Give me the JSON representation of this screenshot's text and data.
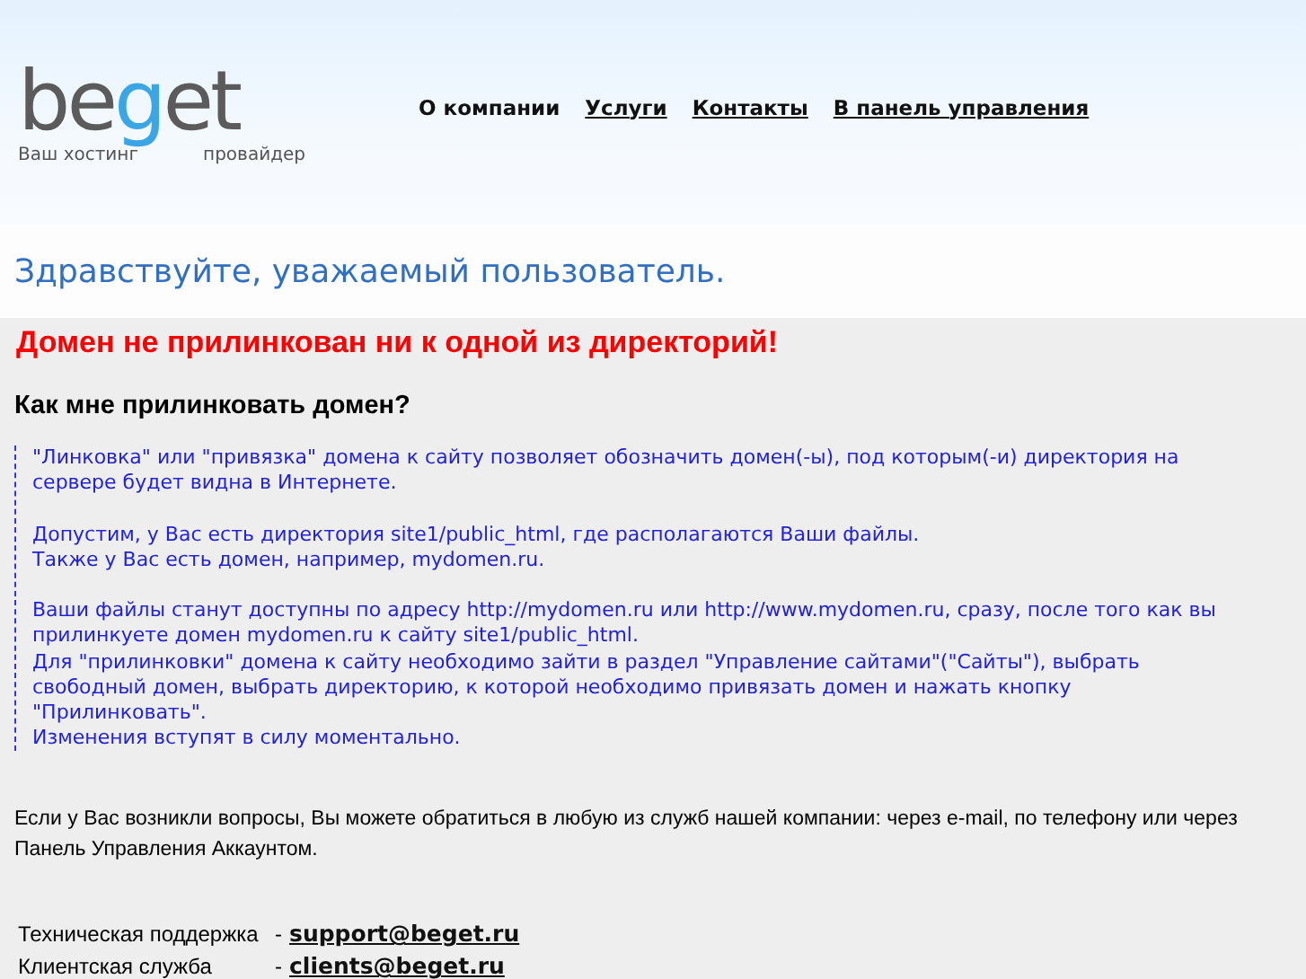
{
  "logo": {
    "name": "beget",
    "tagline_left": "Ваш  хостинг",
    "tagline_right": "провайдер"
  },
  "nav": [
    {
      "label": "О компании",
      "link": false
    },
    {
      "label": "Услуги",
      "link": true
    },
    {
      "label": "Контакты",
      "link": true
    },
    {
      "label": "В панель управления",
      "link": true
    }
  ],
  "greeting": "Здравствуйте, уважаемый пользователь.",
  "error": "Домен не прилинкован ни к одной из директорий!",
  "question": "Как мне прилинковать домен?",
  "instructions": [
    [
      "\"Линковка\" или \"привязка\" домена к сайту позволяет обозначить домен(-ы), под которым(-и) директория на сервере будет видна в Интернете."
    ],
    [
      "Допустим, у Вас есть директория site1/public_html, где располагаются Ваши файлы.",
      "Также у Вас есть домен, например, mydomen.ru."
    ],
    [
      "Ваши файлы станут доступны по адресу http://mydomen.ru или http://www.mydomen.ru, сразу, после того как вы прилинкуете домен mydomen.ru к сайту site1/public_html.",
      "Для \"прилинковки\" домена к сайту необходимо зайти в раздел \"Управление сайтами\"(\"Сайты\"), выбрать свободный домен, выбрать директорию, к которой необходимо привязать домен и нажать кнопку \"Прилинковать\".",
      "Изменения вступят в силу моментально."
    ]
  ],
  "contact_note": "Если у Вас возникли вопросы, Вы можете обратиться в любую из служб нашей компании: через e-mail, по телефону или через Панель Управления Аккаунтом.",
  "contacts": [
    {
      "service": "Техническая поддержка",
      "dash": "-",
      "email": "support@beget.ru"
    },
    {
      "service": "Клиентская служба",
      "dash": "-",
      "email": "clients@beget.ru"
    }
  ]
}
